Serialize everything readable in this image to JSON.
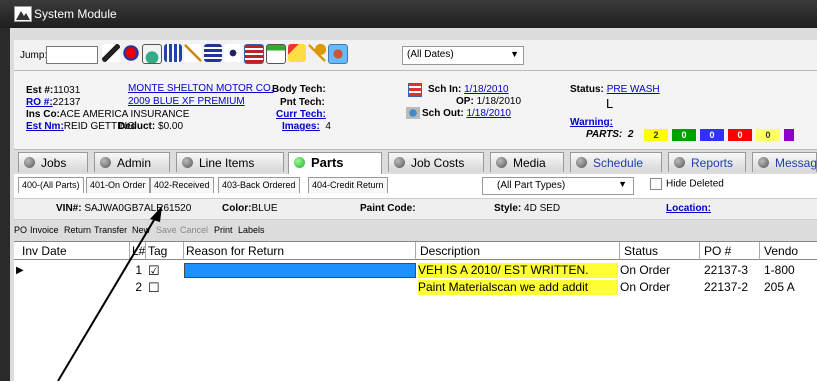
{
  "window": {
    "title": "System Module"
  },
  "toolbar": {
    "jump_label": "Jump:",
    "jump_value": "",
    "date_filter": "(All Dates)",
    "icons": [
      "pen-icon",
      "record-icon",
      "home-icon",
      "calendar-icon",
      "wand-icon",
      "grid-icon",
      "info-icon",
      "table-icon",
      "form-icon",
      "note-icon",
      "key-icon",
      "puzzle-icon"
    ]
  },
  "estimate": {
    "est_label": "Est #:",
    "est_value": "11031",
    "ro_label": "RO #:",
    "ro_value": "22137",
    "ins_label": "Ins Co:",
    "ins_value": "ACE AMERICA INSURANCE",
    "estnm_label": "Est Nm:",
    "estnm_value": "REID GETTING",
    "customer": "MONTE SHELTON MOTOR CO.",
    "vehicle": "2009 BLUE XF PREMIUM",
    "deduct_label": "Deduct:",
    "deduct_value": "$0.00",
    "body_tech": "Body Tech:",
    "pnt_tech": "Pnt Tech:",
    "curr_tech": "Curr Tech:",
    "images_label": "Images:",
    "images_value": "4",
    "sch_in_label": "Sch In:",
    "sch_in_value": "1/18/2010",
    "op_label": "OP:",
    "op_value": "1/18/2010",
    "sch_out_label": "Sch Out:",
    "sch_out_value": "1/18/2010",
    "status_label": "Status:",
    "status_value": "PRE WASH",
    "status_mark": "L",
    "warning_label": "Warning:",
    "parts_label": "PARTS:",
    "parts_value": "2",
    "badges": [
      {
        "text": "2",
        "color": "#ffff00"
      },
      {
        "text": "0",
        "color": "#00a000"
      },
      {
        "text": "0",
        "color": "#3030ff"
      },
      {
        "text": "0",
        "color": "#ff0000"
      },
      {
        "text": "0",
        "color": "#ffff66"
      },
      {
        "text": "",
        "color": "#8a00c8"
      }
    ]
  },
  "tabs": [
    {
      "label": "Jobs"
    },
    {
      "label": "Admin"
    },
    {
      "label": "Line Items"
    },
    {
      "label": "Parts",
      "active": true
    },
    {
      "label": "Job Costs"
    },
    {
      "label": "Media"
    },
    {
      "label": "Schedule"
    },
    {
      "label": "Reports"
    },
    {
      "label": "Messag"
    }
  ],
  "subtabs": [
    "400-(All Parts)",
    "401-On Order",
    "402-Received",
    "403-Back Ordered",
    "404-Credit Return"
  ],
  "part_types": "(All Part Types)",
  "hide_deleted": "Hide Deleted",
  "vin": {
    "vin_label": "VIN#:",
    "vin_value": "SAJWA0GB7ALR61520",
    "color_label": "Color:",
    "color_value": "BLUE",
    "paint_label": "Paint Code:",
    "style_label": "Style:",
    "style_value": "4D SED",
    "location_label": "Location:"
  },
  "actions": [
    "PO",
    "Invoice",
    "Return",
    "Transfer",
    "New",
    "Save",
    "Cancel",
    "Print",
    "Labels"
  ],
  "grid": {
    "headers": [
      "Inv Date",
      "L#",
      "Tag",
      "Reason for Return",
      "Description",
      "Status",
      "PO #",
      "Vendo"
    ],
    "rows": [
      {
        "line": "1",
        "tag": "☑",
        "reason": "",
        "description": "VEH IS A 2010/ EST WRITTEN.",
        "status": "On Order",
        "po": "22137-3",
        "vendor": "1-800"
      },
      {
        "line": "2",
        "tag": "☐",
        "reason": "",
        "description": "Paint Materialscan we add addit",
        "status": "On Order",
        "po": "22137-2",
        "vendor": "205 A"
      }
    ]
  }
}
